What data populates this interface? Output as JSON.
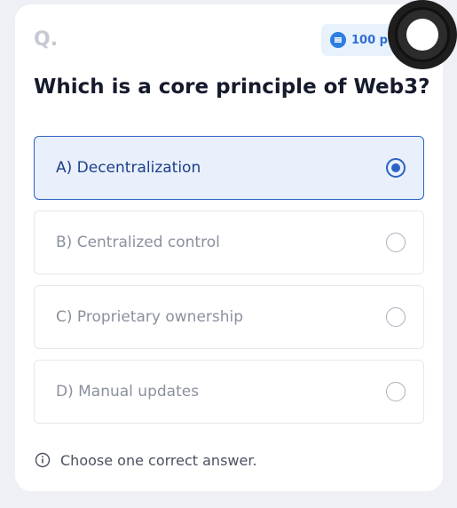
{
  "question": {
    "label": "Q.",
    "text": "Which is a core principle of Web3?"
  },
  "points_badge": {
    "text": "100 p",
    "icon": "coin-icon",
    "color": "#2f7de1"
  },
  "options": [
    {
      "label": "A) Decentralization",
      "selected": true
    },
    {
      "label": "B) Centralized control",
      "selected": false
    },
    {
      "label": "C) Proprietary ownership",
      "selected": false
    },
    {
      "label": "D) Manual updates",
      "selected": false
    }
  ],
  "hint": {
    "text": "Choose one correct answer.",
    "icon": "info-icon"
  },
  "colors": {
    "accent": "#2b62c4",
    "selected_bg": "#e9f0fb",
    "background": "#eef0f6"
  }
}
